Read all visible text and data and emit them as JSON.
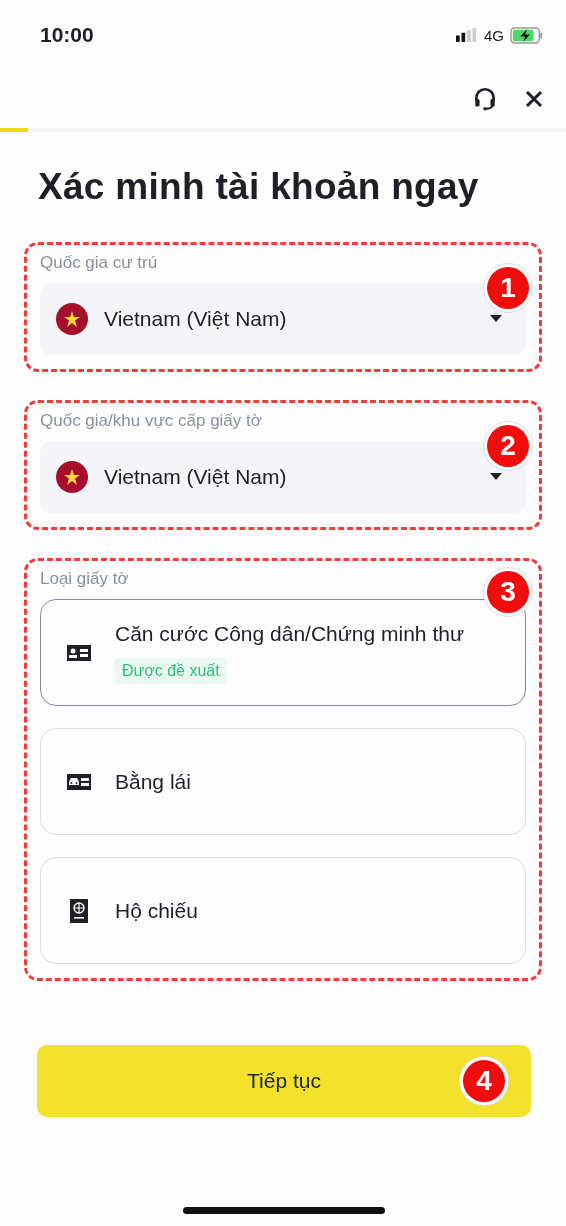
{
  "status_bar": {
    "time": "10:00",
    "network": "4G"
  },
  "progress": {
    "level": 0.05
  },
  "title": "Xác minh tài khoản ngay",
  "sections": [
    {
      "kind": "select",
      "label": "Quốc gia cư trú",
      "value": "Vietnam (Việt Nam)",
      "badge": "1"
    },
    {
      "kind": "select",
      "label": "Quốc gia/khu vực cấp giấy tờ",
      "value": "Vietnam (Việt Nam)",
      "badge": "2"
    },
    {
      "kind": "options",
      "label": "Loại giấy tờ",
      "badge": "3",
      "options": [
        {
          "kind": "id-card",
          "label": "Căn cước Công dân/Chứng minh thư",
          "tag": "Được đề xuất",
          "selected": true
        },
        {
          "kind": "license",
          "label": "Bằng lái",
          "selected": false
        },
        {
          "kind": "passport",
          "label": "Hộ chiếu",
          "selected": false
        }
      ]
    }
  ],
  "button": {
    "label": "Tiếp tục",
    "badge": "4"
  }
}
